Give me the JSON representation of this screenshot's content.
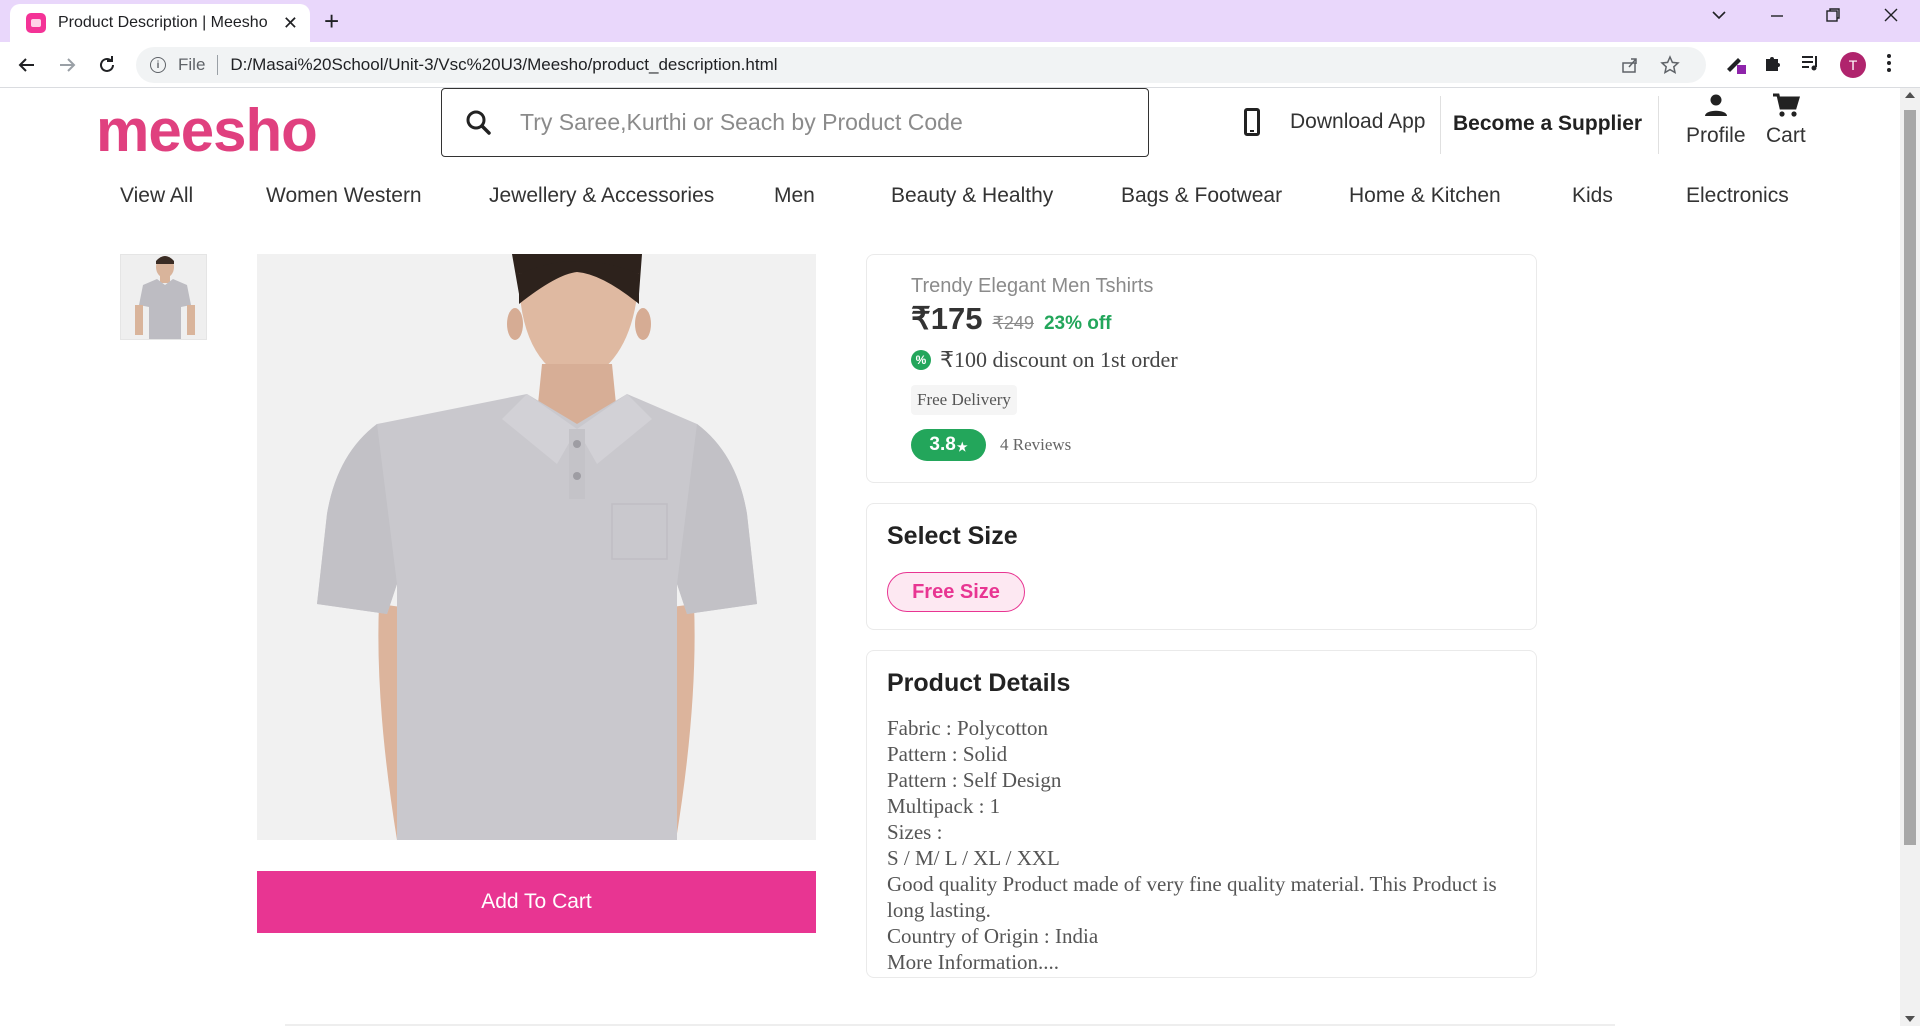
{
  "browser": {
    "tab_title": "Product Description | Meesho",
    "tab_close": "✕",
    "new_tab": "+",
    "file_label": "File",
    "url": "D:/Masai%20School/Unit-3/Vsc%20U3/Meesho/product_description.html",
    "profile_initial": "T"
  },
  "header": {
    "logo": "meesho",
    "search_placeholder": "Try Saree,Kurthi or Seach by Product Code",
    "download_app": "Download App",
    "become_supplier": "Become a Supplier",
    "profile": "Profile",
    "cart": "Cart"
  },
  "categories": [
    "View All",
    "Women Western",
    "Jewellery & Accessories",
    "Men",
    "Beauty & Healthy",
    "Bags & Footwear",
    "Home & Kitchen",
    "Kids",
    "Electronics"
  ],
  "product": {
    "name": "Trendy Elegant Men Tshirts",
    "price": "₹175",
    "mrp": "₹249",
    "discount_pct": "23% off",
    "first_order_discount": "₹100 discount on 1st order",
    "delivery": "Free Delivery",
    "rating": "3.8",
    "rating_star": "★",
    "reviews": "4 Reviews",
    "add_to_cart": "Add To Cart",
    "shirt_color": "#c9c8cd"
  },
  "size": {
    "title": "Select Size",
    "selected": "Free Size"
  },
  "details": {
    "title": "Product Details",
    "lines": [
      "Fabric : Polycotton",
      "Pattern : Solid",
      "Pattern : Self Design",
      "Multipack : 1",
      "Sizes :",
      "S / M/ L / XL / XXL",
      "Good quality Product made of very fine quality material. This Product is long lasting.",
      "Country of Origin : India",
      "More Information...."
    ]
  },
  "colors": {
    "brand": "#e83592",
    "logo": "#e0407f",
    "success": "#23a65b"
  }
}
